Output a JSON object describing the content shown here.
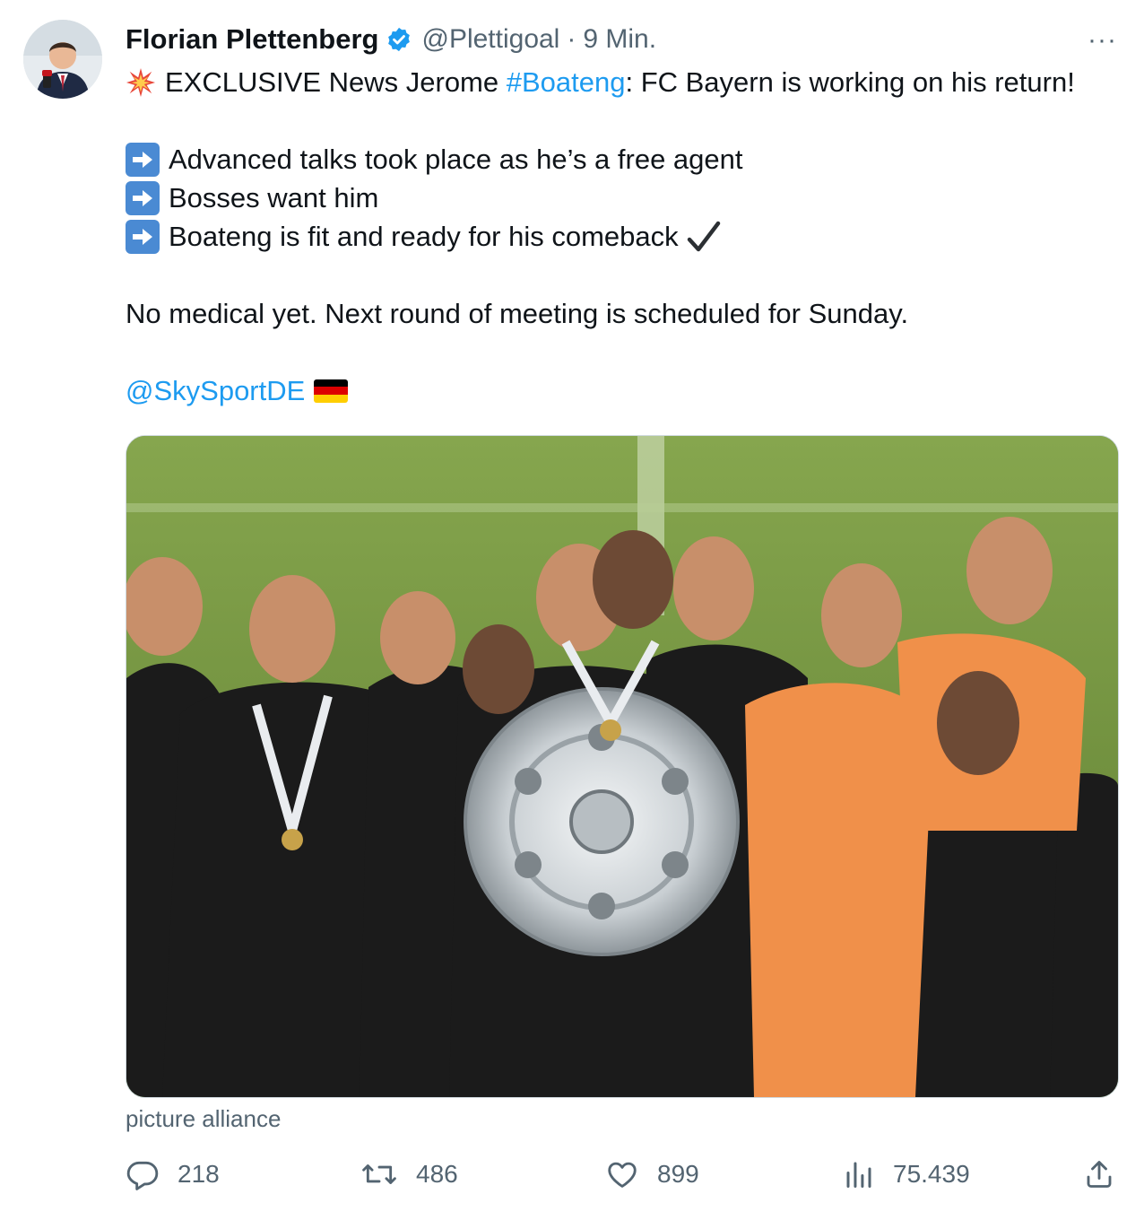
{
  "tweet": {
    "author_name": "Florian Plettenberg",
    "handle": "@Plettigoal",
    "separator": "·",
    "time": "9 Min.",
    "more": "···",
    "line1": {
      "prefix": "EXCLUSIVE News Jerome ",
      "hashtag": "#Boateng",
      "suffix": ": FC Bayern is working on his return!"
    },
    "bullets": [
      "Advanced talks took place as he’s a free agent",
      "Bosses want him",
      "Boateng is fit and ready for his comeback"
    ],
    "followup": "No medical yet. Next round of meeting is scheduled for Sunday.",
    "mention": "@SkySportDE",
    "media_credit": "picture alliance"
  },
  "metrics": {
    "replies": "218",
    "retweets": "486",
    "likes": "899",
    "views": "75.439"
  },
  "icons": {
    "verified": "verified-badge-icon",
    "burst": "collision-emoji-icon",
    "arrow": "right-arrow-emoji-icon",
    "check": "check-mark-icon",
    "flag": "germany-flag-icon",
    "reply": "reply-icon",
    "retweet": "retweet-icon",
    "like": "heart-icon",
    "views": "views-chart-icon",
    "share": "share-icon"
  },
  "colors": {
    "link": "#1d9bf0",
    "secondary_text": "#536471",
    "primary_text": "#0f1419",
    "arrow_emoji_bg": "#4a8ad3",
    "flag": [
      "#000000",
      "#dd0000",
      "#ffce00"
    ]
  }
}
